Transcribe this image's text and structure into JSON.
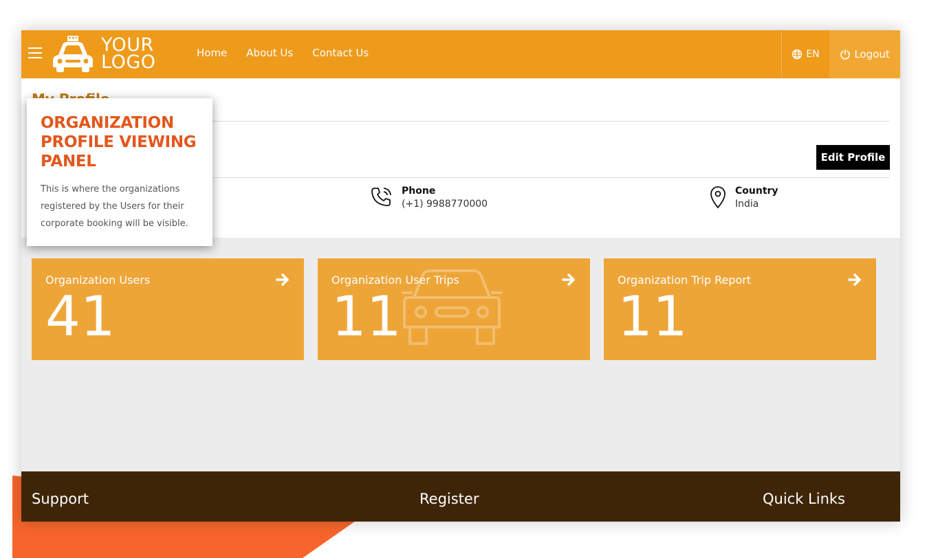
{
  "header": {
    "logo": {
      "line1": "YOUR",
      "line2": "LOGO",
      "icon": "taxi-car-icon"
    },
    "menu_icon": "hamburger-menu-icon",
    "nav": [
      "Home",
      "About Us",
      "Contact Us"
    ],
    "language": {
      "icon": "globe-icon",
      "label": "EN"
    },
    "logout": {
      "icon": "power-icon",
      "label": "Logout"
    }
  },
  "profile": {
    "title": "My Profile",
    "edit_button": "Edit Profile",
    "phone": {
      "icon": "phone-icon",
      "label": "Phone",
      "value": "(+1) 9988770000"
    },
    "country": {
      "icon": "map-pin-icon",
      "label": "Country",
      "value": "India"
    }
  },
  "cards": [
    {
      "title": "Organization Users",
      "value": "41",
      "icon": "arrow-right-icon"
    },
    {
      "title": "Organization User Trips",
      "value": "11",
      "icon": "arrow-right-icon",
      "background_icon": "car-icon"
    },
    {
      "title": "Organization Trip Report",
      "value": "11",
      "icon": "arrow-right-icon"
    }
  ],
  "footer": {
    "support": "Support",
    "register": "Register",
    "quick_links": "Quick Links"
  },
  "tooltip": {
    "title": "ORGANIZATION PROFILE VIEWING PANEL",
    "body": "This is where the organizations registered by the Users for their corporate booking will be visible."
  },
  "colors": {
    "accent": "#ee9a1a",
    "card": "#eea538",
    "footer": "#3e2508",
    "tooltip_title": "#e3571c",
    "decor": "#f7652c"
  }
}
